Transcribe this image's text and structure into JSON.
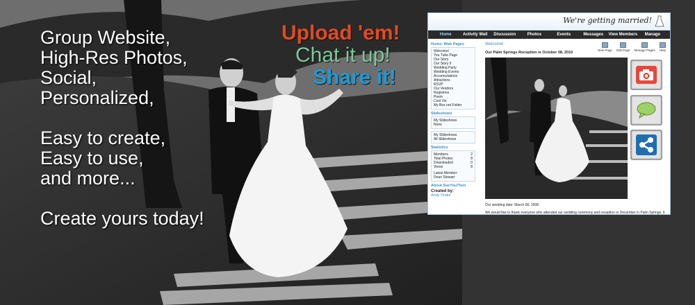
{
  "pitch": {
    "line1": "Group Website,",
    "line2": "High-Res Photos,",
    "line3": "Social,",
    "line4": "Personalized,",
    "line5": "Easy to create,",
    "line6": "Easy to use,",
    "line7": "and more...",
    "line8": "Create yours today!"
  },
  "taglines": {
    "upload": "Upload 'em!",
    "chat": "Chat it up!",
    "share": "Share it!"
  },
  "site": {
    "title": "We're getting married!",
    "nav": [
      "Home",
      "Activity Wall",
      "Discussion",
      "Photos",
      "Events",
      "Messages",
      "View Members",
      "Manage"
    ],
    "home_heading": "Home: Web Pages",
    "pages": [
      "Welcome!",
      "You Tube Page",
      "Our Story",
      "Our Story II",
      "Wedding Party",
      "Wedding Events",
      "Accomodations",
      "Attractions",
      "RSVP",
      "Our Vendors",
      "Registries",
      "Poem",
      "Cool Vis",
      "My Box.net Folder"
    ],
    "slideshows_heading": "Slideshows",
    "slideshows_box1": [
      "My Slideshows",
      "None"
    ],
    "slideshows_box2": [
      "My Slideshows",
      "All Slideshows"
    ],
    "statistics_heading": "Statistics",
    "stats": [
      {
        "label": "Members",
        "value": "2"
      },
      {
        "label": "Total Photos",
        "value": "8"
      },
      {
        "label": "Downloaded",
        "value": "0"
      },
      {
        "label": "Views",
        "value": "8"
      }
    ],
    "latest_member_label": "Latest Member:",
    "latest_member": "Dean Stewart",
    "about_heading": "About SeeYouThen",
    "created_by_label": "Created by:",
    "created_by": "Andy Drake",
    "welcome": "Welcome!",
    "toolbar": [
      "New Page",
      "Edit Page",
      "Manage Pages",
      "Help"
    ],
    "post_title": "Our Palm Springs Reception is October 08, 2010",
    "caption": "Our wedding date: March 08, 2008",
    "body": "We would like to thank everyone who attended our wedding ceremony and reception in December in Palm Springs. It"
  },
  "actions": {
    "upload_icon": "camera-icon",
    "chat_icon": "speech-bubble-icon",
    "share_icon": "share-icon"
  },
  "colors": {
    "upload": "#e04b22",
    "chat": "#7ec99a",
    "share": "#1e9ad6",
    "camera_button": "#e8483a",
    "chat_bubble": "#9ed266",
    "share_button": "#1f6fb0"
  }
}
